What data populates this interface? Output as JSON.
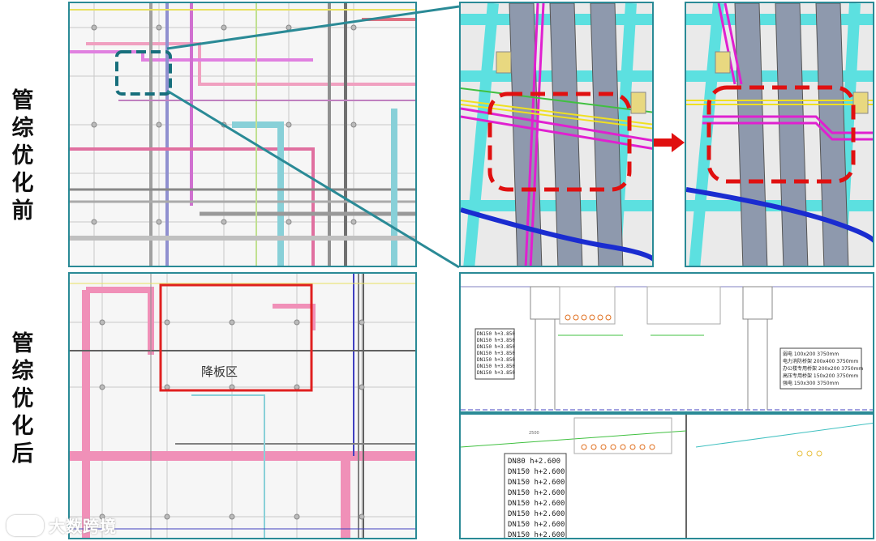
{
  "labels": {
    "before": [
      "管",
      "综",
      "优",
      "化",
      "前"
    ],
    "after": [
      "管",
      "综",
      "优",
      "化",
      "后"
    ]
  },
  "plan_after": {
    "zone_label": "降板区"
  },
  "section_top": {
    "pipe_rows": [
      "DN150 h+3.850",
      "DN150 h+3.850",
      "DN150 h+3.850",
      "DN150 h+3.850",
      "DN150 h+3.850",
      "DN150 h+3.850",
      "DN150 h+3.850",
      "DN150 h+3.850"
    ],
    "tray_rows": [
      "弱电 100x200  3750mm",
      "电力消防桥架 200x400  3750mm",
      "办公楼专用桥架 200x200  3750mm",
      "高压专用桥架 150x200  3750mm",
      "强电 150x300  3750mm"
    ]
  },
  "section_bottom": {
    "pipe_rows": [
      "DN80  h+2.600",
      "DN150 h+2.600",
      "DN150 h+2.600",
      "DN150 h+2.600",
      "DN150 h+2.600",
      "DN150 h+2.600",
      "DN150 h+2.600",
      "DN150 h+2.600"
    ],
    "dim": "2500"
  },
  "watermark": "大数跨境",
  "colors": {
    "frame": "#2a8a96",
    "highlight": "#e01010",
    "arrow": "#e01010"
  }
}
